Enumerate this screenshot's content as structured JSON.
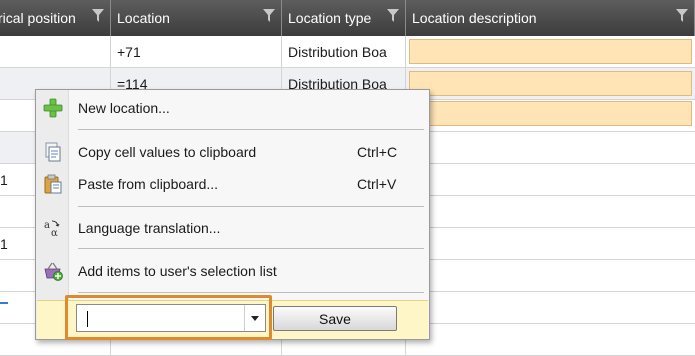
{
  "grid": {
    "columns": [
      {
        "label": "rical position"
      },
      {
        "label": "Location"
      },
      {
        "label": "Location type"
      },
      {
        "label": "Location description"
      }
    ],
    "rows": [
      {
        "pos": "",
        "location": "+71",
        "type": "Distribution Boa"
      },
      {
        "pos": "",
        "location": "=114",
        "type": "Distribution Boa"
      },
      {
        "pos": "",
        "location": "",
        "type": ""
      },
      {
        "pos": "",
        "location": "",
        "type": ""
      },
      {
        "pos": "1",
        "location": "",
        "type": ""
      },
      {
        "pos": "",
        "location": "",
        "type": ""
      },
      {
        "pos": "1",
        "location": "",
        "type": ""
      },
      {
        "pos": "",
        "location": "",
        "type": ""
      },
      {
        "pos": "",
        "location": "",
        "type": ""
      },
      {
        "pos": "",
        "location": "",
        "type": ""
      }
    ]
  },
  "menu": {
    "new_location": "New location...",
    "copy_cells": "Copy cell values to clipboard",
    "copy_shortcut": "Ctrl+C",
    "paste": "Paste from clipboard...",
    "paste_shortcut": "Ctrl+V",
    "translation": "Language translation...",
    "add_selection": "Add items to user's selection list",
    "selection_input_value": "",
    "save_label": "Save"
  },
  "colors": {
    "header_bg": "#4a4a4a",
    "desc_highlight": "#ffe4b5",
    "focus_frame": "#e08a2e",
    "strip_bg": "#fff6c8"
  }
}
